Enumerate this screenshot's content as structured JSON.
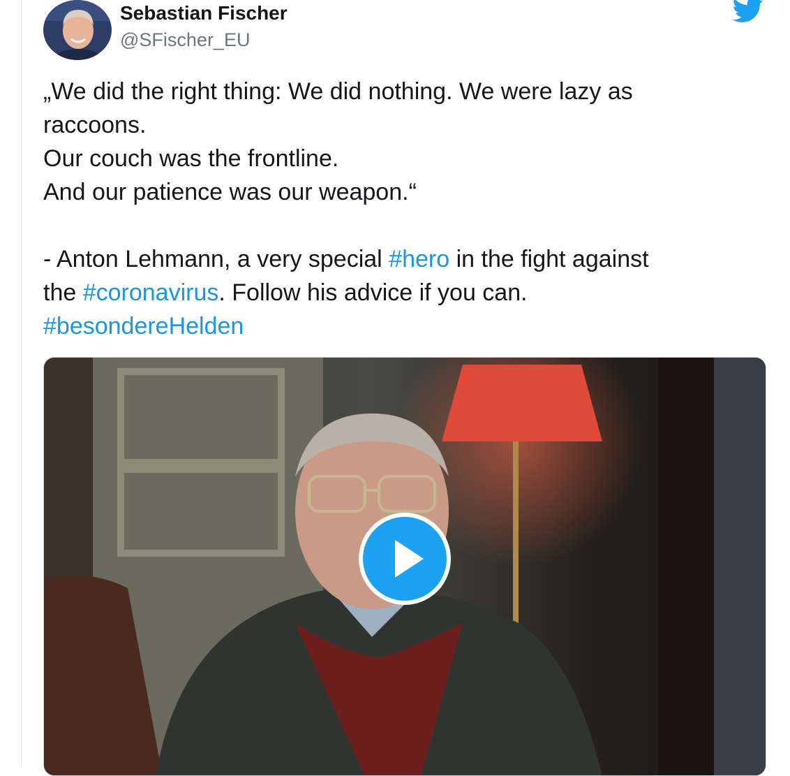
{
  "author": {
    "name": "Sebastian Fischer",
    "handle": "@SFischer_EU",
    "avatar_icon": "profile-photo"
  },
  "brand_icon": "twitter-bird-icon",
  "colors": {
    "hashtag": "#1b95e0",
    "twitter_blue": "#1da1f2",
    "text": "#14171a",
    "secondary": "#657786"
  },
  "tweet": {
    "lines": [
      "„We did the right thing: We did nothing. We were lazy as",
      "raccoons.",
      "Our couch was the frontline.",
      "And our patience was our weapon.“"
    ],
    "attribution": {
      "part1": "- Anton Lehmann, a very special ",
      "tag1": "#hero",
      "part2": " in the fight against",
      "part3": "the ",
      "tag2": "#coronavirus",
      "part4": ". Follow his advice if you can.",
      "tag3": "#besondereHelden"
    }
  },
  "media": {
    "type": "video",
    "play_icon": "play-icon"
  }
}
